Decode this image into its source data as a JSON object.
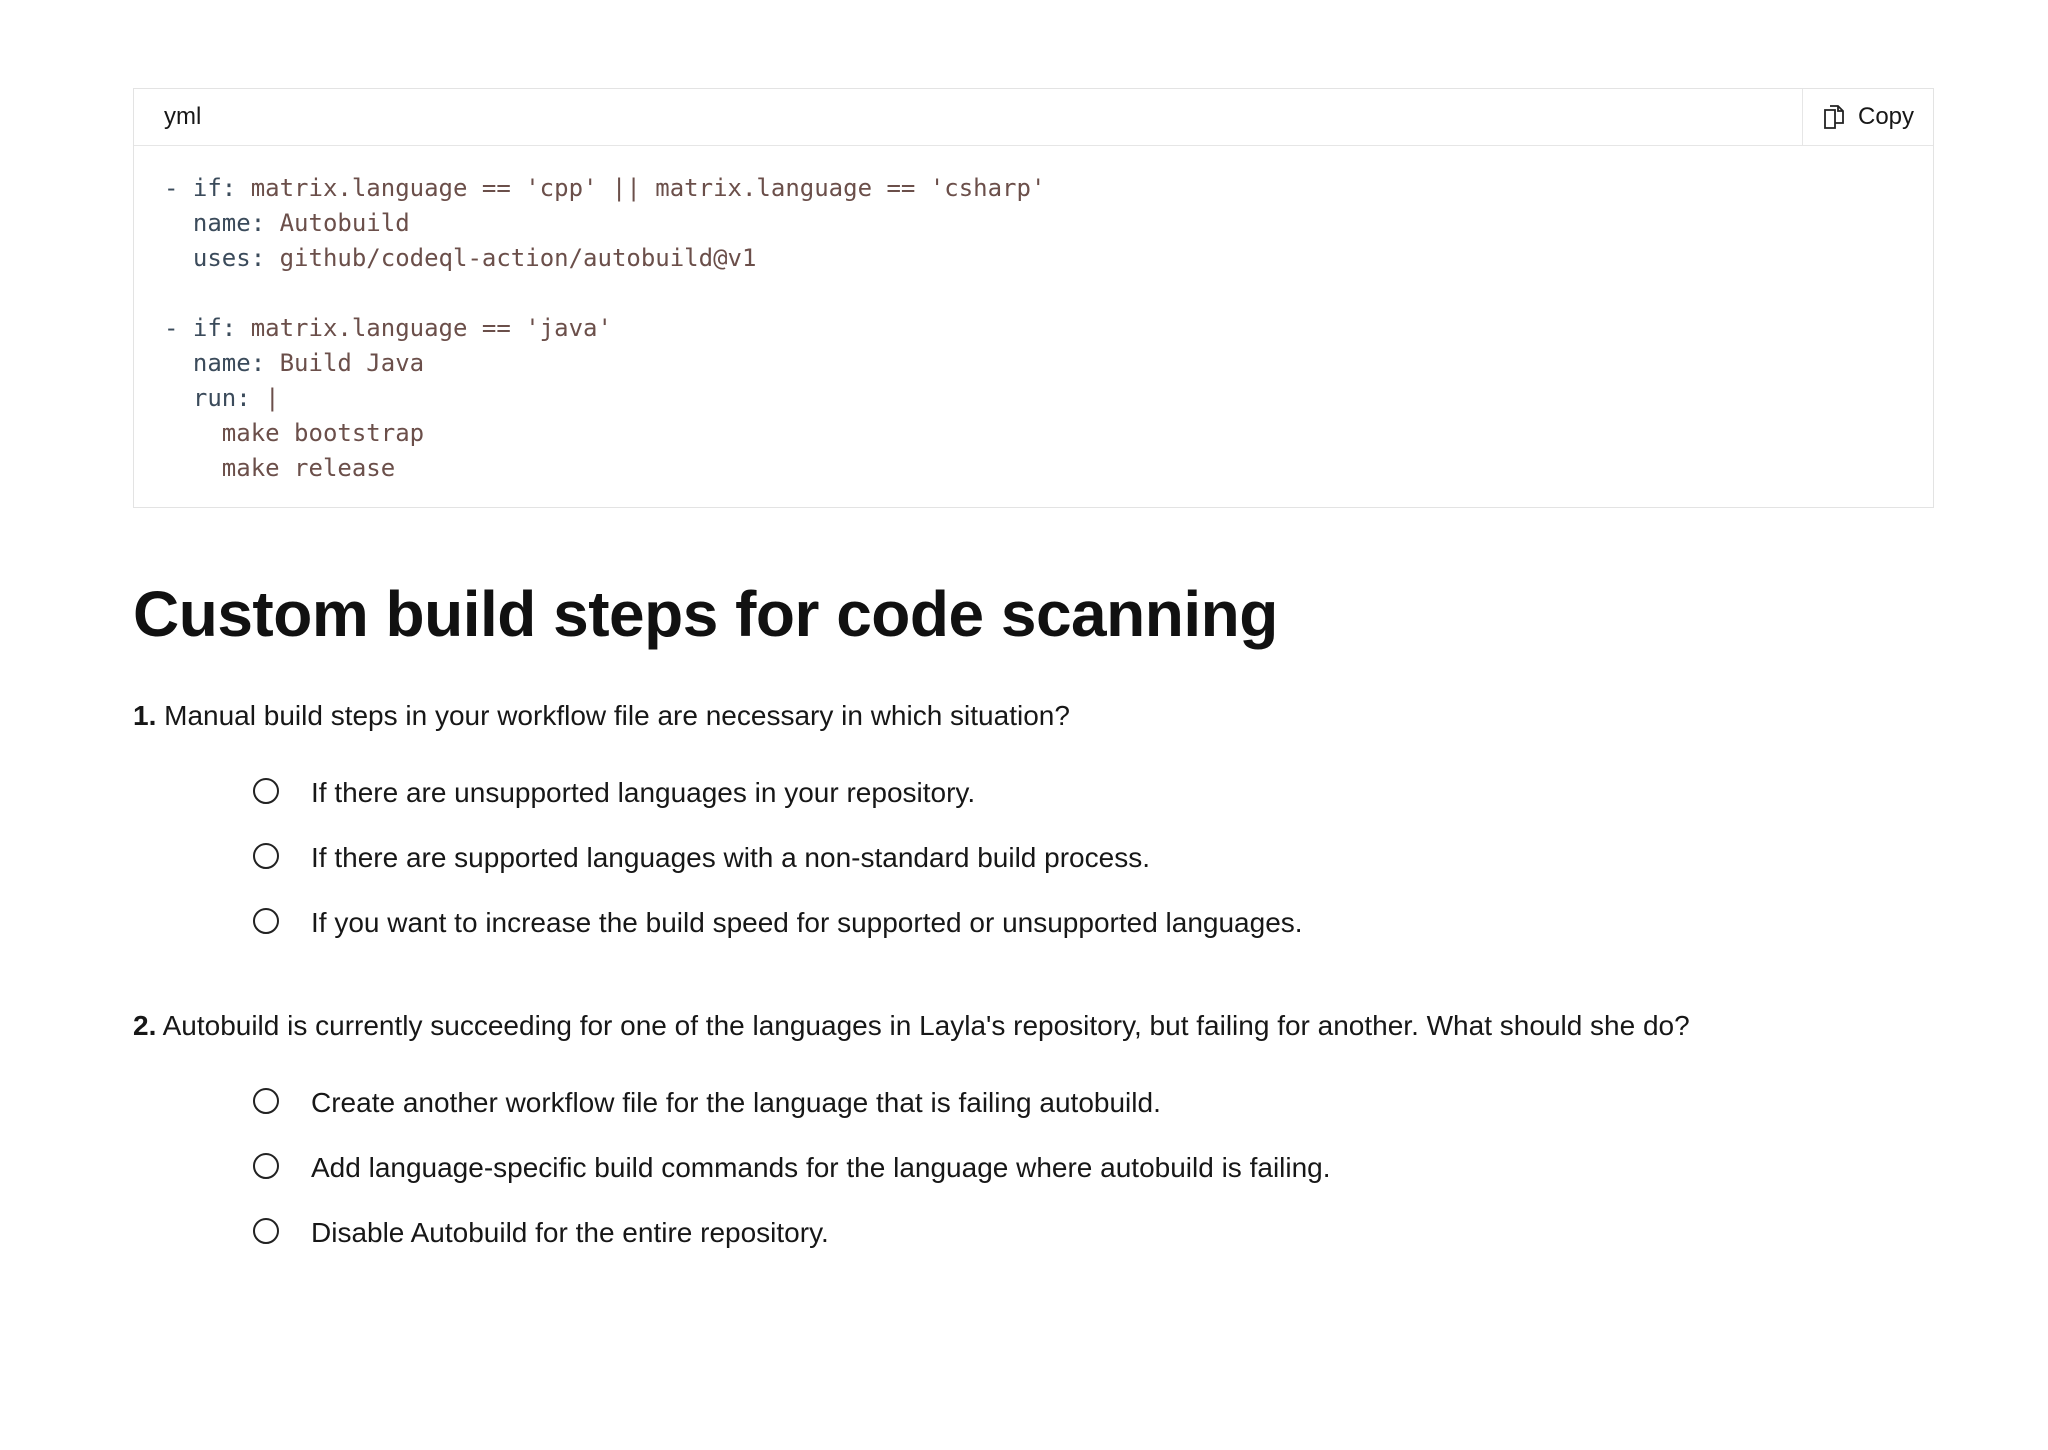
{
  "code_block": {
    "language": "yml",
    "copy_label": "Copy",
    "copy_icon": "copy-icon",
    "lines": [
      {
        "indent": "",
        "key": "- if:",
        "value": " matrix.language == 'cpp' || matrix.language == 'csharp'"
      },
      {
        "indent": "  ",
        "key": "name:",
        "value": " Autobuild"
      },
      {
        "indent": "  ",
        "key": "uses:",
        "value": " github/codeql-action/autobuild@v1"
      },
      {
        "indent": "",
        "key": "",
        "value": ""
      },
      {
        "indent": "",
        "key": "- if:",
        "value": " matrix.language == 'java'"
      },
      {
        "indent": "  ",
        "key": "name:",
        "value": " Build Java"
      },
      {
        "indent": "  ",
        "key": "run:",
        "value": " |"
      },
      {
        "indent": "    ",
        "key": "",
        "value": "make bootstrap"
      },
      {
        "indent": "    ",
        "key": "",
        "value": "make release"
      }
    ]
  },
  "page_title": "Custom build steps for code scanning",
  "questions": [
    {
      "number": "1.",
      "text": "Manual build steps in your workflow file are necessary in which situation?",
      "options": [
        "If there are unsupported languages in your repository.",
        "If there are supported languages with a non-standard build process.",
        "If you want to increase the build speed for supported or unsupported languages."
      ]
    },
    {
      "number": "2.",
      "text": "Autobuild is currently succeeding for one of the languages in Layla's repository, but failing for another. What should she do?",
      "options": [
        "Create another workflow file for the language that is failing autobuild.",
        "Add language-specific build commands for the language where autobuild is failing.",
        "Disable Autobuild for the entire repository."
      ]
    }
  ]
}
